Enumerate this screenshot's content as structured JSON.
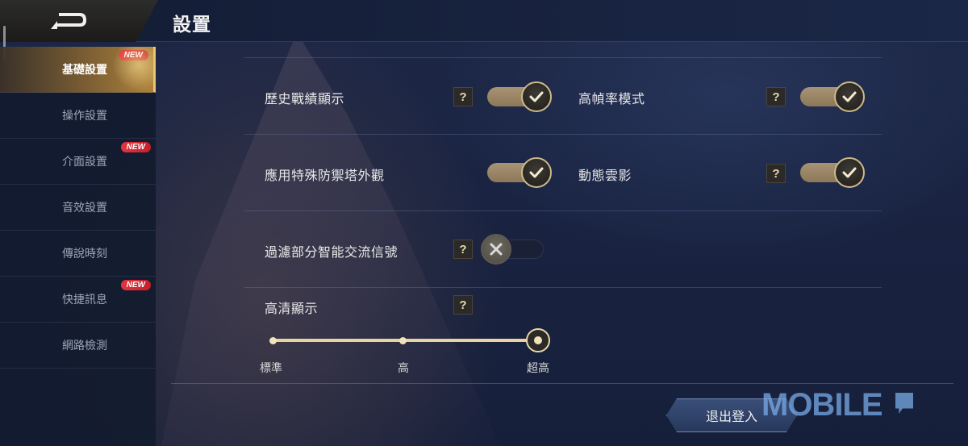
{
  "header": {
    "title": "設置"
  },
  "sidebar": {
    "new_badge": "NEW",
    "items": [
      {
        "label": "基礎設置",
        "active": true,
        "new": true
      },
      {
        "label": "操作設置",
        "active": false,
        "new": false
      },
      {
        "label": "介面設置",
        "active": false,
        "new": true
      },
      {
        "label": "音效設置",
        "active": false,
        "new": false
      },
      {
        "label": "傳說時刻",
        "active": false,
        "new": false
      },
      {
        "label": "快捷訊息",
        "active": false,
        "new": true
      },
      {
        "label": "網路檢測",
        "active": false,
        "new": false
      }
    ]
  },
  "settings": {
    "help_icon": "?",
    "history": {
      "label": "歷史戰績顯示",
      "enabled": true
    },
    "high_fps": {
      "label": "高幀率模式",
      "enabled": true
    },
    "tower_skin": {
      "label": "應用特殊防禦塔外觀",
      "enabled": true
    },
    "cloud_shadow": {
      "label": "動態雲影",
      "enabled": true
    },
    "filter_signals": {
      "label": "過濾部分智能交流信號",
      "enabled": false
    },
    "hd_display": {
      "label": "高清顯示",
      "options": [
        "標準",
        "高",
        "超高"
      ],
      "selected": "超高"
    }
  },
  "footer": {
    "logout_label": "退出登入"
  },
  "watermark": {
    "text": "MOBILE"
  },
  "colors": {
    "accent_gold": "#e8d3a2",
    "badge_red": "#e5343f",
    "button_blue": "#3a4f78"
  }
}
